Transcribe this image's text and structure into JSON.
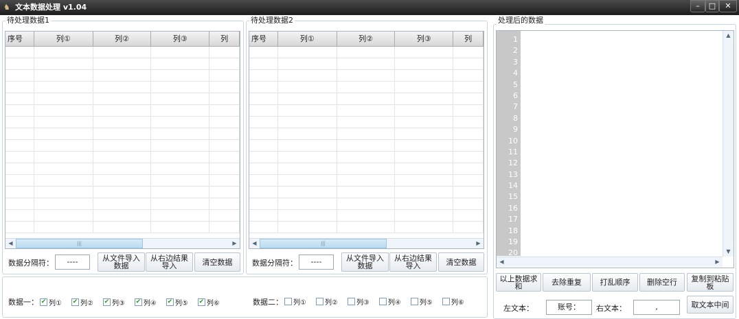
{
  "window": {
    "title": "文本数据处理 v1.04",
    "minimize": "–",
    "maximize": "□",
    "close": "✕"
  },
  "panel1": {
    "legend": "待处理数据1",
    "columns": [
      "序号",
      "列①",
      "列②",
      "列③",
      "列"
    ],
    "separator_label": "数据分隔符：",
    "separator_value": "----",
    "btn_import_file": "从文件导入数据",
    "btn_import_right": "从右边结果导入",
    "btn_clear": "清空数据"
  },
  "panel2": {
    "legend": "待处理数据2",
    "columns": [
      "序号",
      "列①",
      "列②",
      "列③",
      "列"
    ],
    "separator_label": "数据分隔符：",
    "separator_value": "----",
    "btn_import_file": "从文件导入数据",
    "btn_import_right": "从右边结果导入",
    "btn_clear": "清空数据"
  },
  "options": {
    "data1": {
      "label": "数据一：",
      "items": [
        {
          "label": "列①",
          "checked": true
        },
        {
          "label": "列②",
          "checked": true
        },
        {
          "label": "列③",
          "checked": true
        },
        {
          "label": "列④",
          "checked": true
        },
        {
          "label": "列⑤",
          "checked": true
        },
        {
          "label": "列⑥",
          "checked": true
        }
      ]
    },
    "data2": {
      "label": "数据二：",
      "items": [
        {
          "label": "列①",
          "checked": false
        },
        {
          "label": "列②",
          "checked": false
        },
        {
          "label": "列③",
          "checked": false
        },
        {
          "label": "列④",
          "checked": false
        },
        {
          "label": "列⑤",
          "checked": false
        },
        {
          "label": "列⑥",
          "checked": false
        }
      ]
    }
  },
  "result": {
    "legend": "处理后的数据",
    "line_numbers": [
      "1",
      "2",
      "3",
      "4",
      "5",
      "6",
      "7",
      "8",
      "9",
      "10",
      "11",
      "12",
      "13",
      "14",
      "15",
      "16",
      "17",
      "18",
      "19",
      "20"
    ],
    "buttons": [
      "以上数据求和",
      "去除重复",
      "打乱顺序",
      "删除空行",
      "复制到粘贴板"
    ],
    "left_text_label": "左文本：",
    "left_text_value": "账号：",
    "right_text_label": "右文本：",
    "right_text_value": ",",
    "btn_middle": "取文本中间"
  }
}
